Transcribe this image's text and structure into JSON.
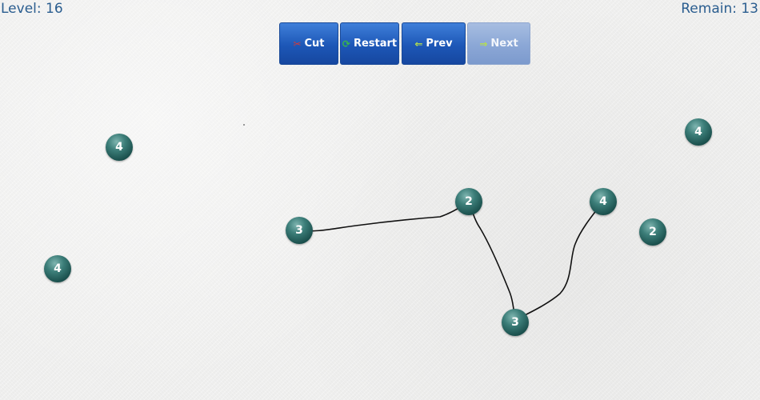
{
  "hud": {
    "level": "Level: 16",
    "remain": "Remain: 13"
  },
  "toolbar": {
    "cut_label": "Cut",
    "restart_label": "Restart",
    "prev_label": "Prev",
    "next_label": "Next"
  },
  "nodes": [
    {
      "id": "n1",
      "value": "4"
    },
    {
      "id": "n2",
      "value": "4"
    },
    {
      "id": "n3",
      "value": "2"
    },
    {
      "id": "n4",
      "value": "4"
    },
    {
      "id": "n5",
      "value": "3"
    },
    {
      "id": "n6",
      "value": "2"
    },
    {
      "id": "n7",
      "value": "4"
    },
    {
      "id": "n8",
      "value": "3"
    }
  ],
  "colors": {
    "hud_text": "#2a5d8f",
    "button_blue": "#1d57b7",
    "node_teal": "#2c6a66",
    "line": "#111111"
  }
}
